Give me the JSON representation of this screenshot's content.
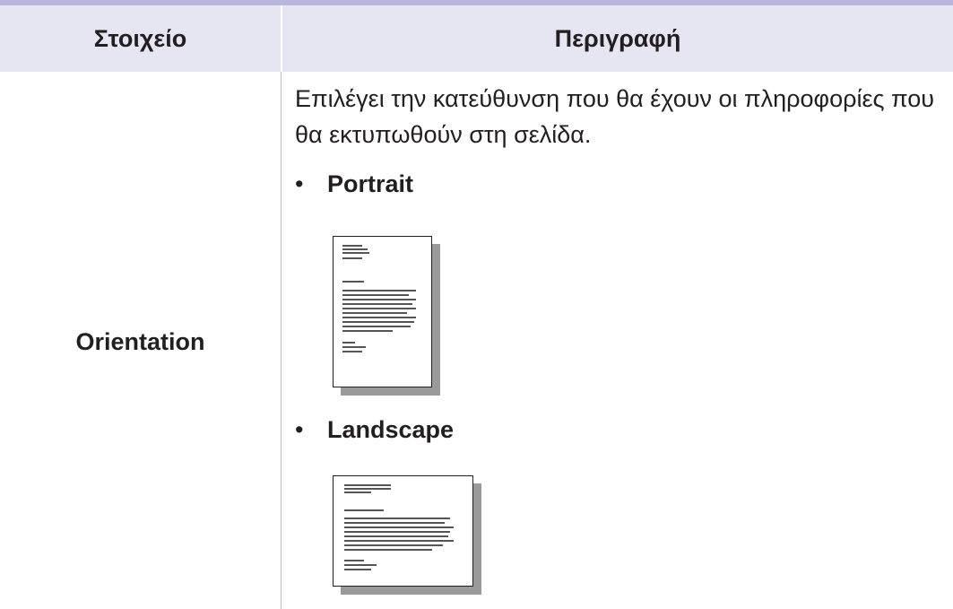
{
  "table": {
    "headers": {
      "item": "Στοιχείο",
      "description": "Περιγραφή"
    },
    "row": {
      "item": "Orientation",
      "description": "Επιλέγει την κατεύθυνση που θα έχουν οι πληροφορίες που θα εκτυπωθούν στη σελίδα.",
      "options": [
        {
          "label": "Portrait",
          "bullet": "•"
        },
        {
          "label": "Landscape",
          "bullet": "•"
        }
      ]
    }
  },
  "colors": {
    "top_rule": "#b8b8dc",
    "header_bg": "#e6e6f2",
    "text": "#231f20",
    "column_divider": "#bdbdbd"
  }
}
